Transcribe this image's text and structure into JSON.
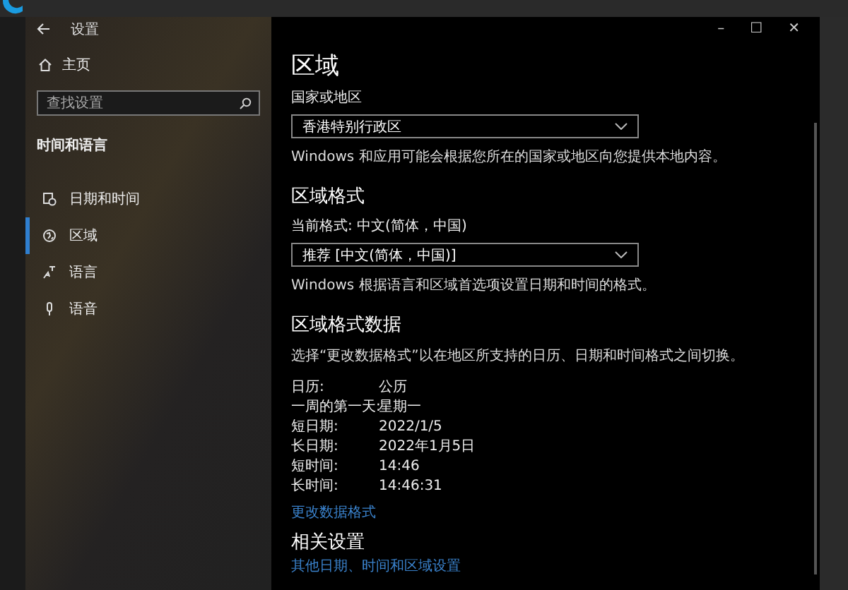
{
  "window": {
    "title": "设置",
    "controls": [
      "–",
      "☐",
      "✕"
    ]
  },
  "sidebar": {
    "home": "主页",
    "search": {
      "placeholder": "查找设置"
    },
    "section": "时间和语言",
    "items": [
      {
        "label": "日期和时间",
        "selected": false
      },
      {
        "label": "区域",
        "selected": true
      },
      {
        "label": "语言",
        "selected": false
      },
      {
        "label": "语音",
        "selected": false
      }
    ]
  },
  "page": {
    "title": "区域",
    "country": {
      "label": "国家或地区",
      "value": "香港特别行政区",
      "description": "Windows 和应用可能会根据您所在的国家或地区向您提供本地内容。"
    },
    "format": {
      "heading": "区域格式",
      "current": "当前格式: 中文(简体，中国)",
      "value": "推荐 [中文(简体，中国)]",
      "description": "Windows 根据语言和区域首选项设置日期和时间的格式。"
    },
    "format_data": {
      "heading": "区域格式数据",
      "description": "选择“更改数据格式”以在地区所支持的日历、日期和时间格式之间切换。",
      "rows": [
        {
          "label": "日历:",
          "value": "公历"
        },
        {
          "label": "一周的第一天:",
          "value": "星期一"
        },
        {
          "label": "短日期:",
          "value": "2022/1/5"
        },
        {
          "label": "长日期:",
          "value": "2022年1月5日"
        },
        {
          "label": "短时间:",
          "value": "14:46"
        },
        {
          "label": "长时间:",
          "value": "14:46:31"
        }
      ],
      "link": "更改数据格式"
    },
    "related": {
      "heading": "相关设置",
      "link": "其他日期、时间和区域设置"
    }
  }
}
